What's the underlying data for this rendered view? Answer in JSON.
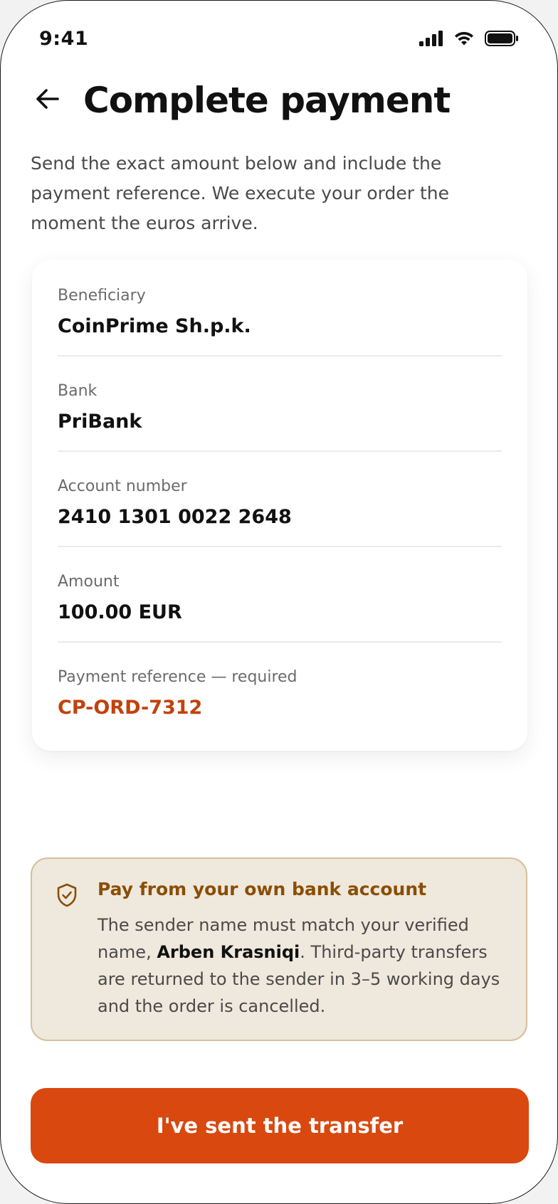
{
  "status_bar": {
    "time": "9:41"
  },
  "header": {
    "title": "Complete payment",
    "back_icon": "arrow-left-icon"
  },
  "intro": "Send the exact amount below and include the payment reference. We execute your order the moment the euros arrive.",
  "details": [
    {
      "label": "Beneficiary",
      "value": "CoinPrime Sh.p.k."
    },
    {
      "label": "Bank",
      "value": "PriBank"
    },
    {
      "label": "Account number",
      "value": "2410 1301 0022 2648"
    },
    {
      "label": "Amount",
      "value": "100.00 EUR"
    },
    {
      "label": "Payment reference — required",
      "value": "CP-ORD-7312"
    }
  ],
  "notice": {
    "icon": "shield-check-icon",
    "title": "Pay from your own bank account",
    "body_before": "The sender name must match your verified name, ",
    "verified_name": "Arben Krasniqi",
    "body_after": ". Third-party transfers are returned to the sender in 3–5 working days and the order is cancelled."
  },
  "cta": {
    "label": "I've sent the transfer"
  },
  "colors": {
    "accent": "#d9480f",
    "reference": "#c2410c",
    "notice_bg": "#efe8dc",
    "notice_border": "#d6bf9c",
    "notice_title": "#8a4e06"
  }
}
